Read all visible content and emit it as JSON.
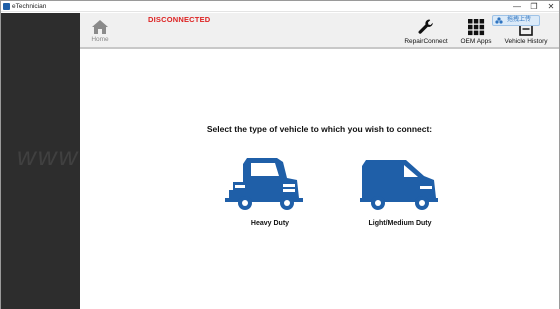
{
  "window": {
    "title": "eTechnician",
    "minimize": "—",
    "restore": "❐",
    "close": "✕"
  },
  "toolbar": {
    "home_label": "Home",
    "status": "DISCONNECTED",
    "repairconnect_label": "RepairConnect",
    "oem_apps_label": "OEM Apps",
    "vehicle_history_label": "Vehicle History",
    "cloud_badge": "拖拽上传"
  },
  "main": {
    "prompt": "Select the type of vehicle to which you wish to connect:",
    "vehicles": [
      {
        "label": "Heavy Duty",
        "icon": "heavy-duty-truck-icon"
      },
      {
        "label": "Light/Medium Duty",
        "icon": "van-icon"
      }
    ]
  },
  "watermark": "www",
  "colors": {
    "brand_blue": "#1f5fa8",
    "status_red": "#d22222",
    "sidebar": "#2d2d2d"
  }
}
